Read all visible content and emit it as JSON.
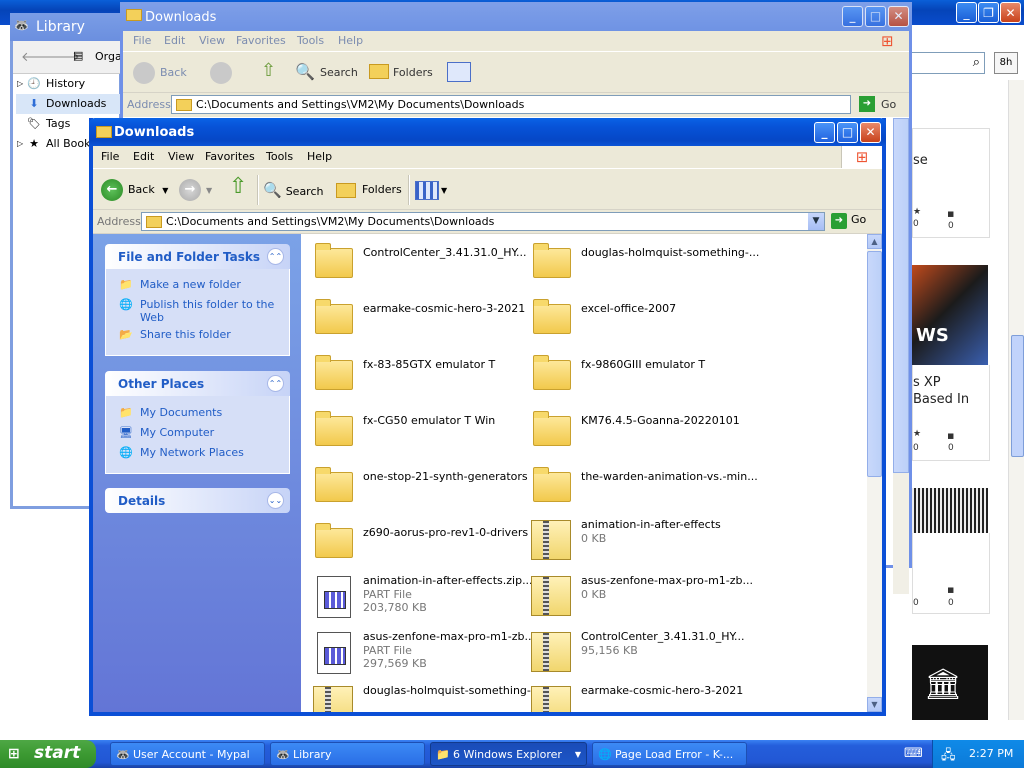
{
  "background_browser": {
    "bg_search_button_text": "8h",
    "cards": [
      {
        "text": "se",
        "likes": "0",
        "comments": "0"
      },
      {
        "text_line1": "s XP",
        "text_line2": "Based In",
        "likes": "0",
        "comments": "0"
      },
      {
        "likes": "0",
        "comments": "0"
      }
    ],
    "image_text": "WS"
  },
  "library_window": {
    "title": "Library",
    "organize": "Orga",
    "items": [
      {
        "label": "History"
      },
      {
        "label": "Downloads"
      },
      {
        "label": "Tags"
      },
      {
        "label": "All Bookm"
      }
    ]
  },
  "back_explorer": {
    "title": "Downloads",
    "menu": [
      "File",
      "Edit",
      "View",
      "Favorites",
      "Tools",
      "Help"
    ],
    "back": "Back",
    "search": "Search",
    "folders": "Folders",
    "address_label": "Address",
    "address": "C:\\Documents and Settings\\VM2\\My Documents\\Downloads",
    "go": "Go"
  },
  "explorer": {
    "title": "Downloads",
    "menu": [
      "File",
      "Edit",
      "View",
      "Favorites",
      "Tools",
      "Help"
    ],
    "toolbar": {
      "back": "Back",
      "search": "Search",
      "folders": "Folders"
    },
    "address_label": "Address",
    "address": "C:\\Documents and Settings\\VM2\\My Documents\\Downloads",
    "go": "Go",
    "task_panels": {
      "file_folder": {
        "title": "File and Folder Tasks",
        "tasks": [
          "Make a new folder",
          "Publish this folder to the",
          "Web",
          "Share this folder"
        ]
      },
      "other_places": {
        "title": "Other Places",
        "links": [
          "My Documents",
          "My Computer",
          "My Network Places"
        ]
      },
      "details": {
        "title": "Details"
      }
    },
    "files": [
      {
        "name": "ControlCenter_3.41.31.0_HY...",
        "type": "folder"
      },
      {
        "name": "douglas-holmquist-something-...",
        "type": "folder"
      },
      {
        "name": "earmake-cosmic-hero-3-2021",
        "type": "folder"
      },
      {
        "name": "excel-office-2007",
        "type": "folder"
      },
      {
        "name": "fx-83-85GTX emulator T",
        "type": "folder"
      },
      {
        "name": "fx-9860GIII emulator T",
        "type": "folder"
      },
      {
        "name": "fx-CG50 emulator T Win",
        "type": "folder"
      },
      {
        "name": "KM76.4.5-Goanna-20220101",
        "type": "folder"
      },
      {
        "name": "one-stop-21-synth-generators",
        "type": "folder"
      },
      {
        "name": "the-warden-animation-vs.-min...",
        "type": "folder"
      },
      {
        "name": "z690-aorus-pro-rev1-0-drivers",
        "type": "folder"
      },
      {
        "name": "animation-in-after-effects",
        "type": "zip",
        "size": "0 KB"
      },
      {
        "name": "animation-in-after-effects.zip....",
        "type": "part",
        "kind": "PART File",
        "size": "203,780 KB"
      },
      {
        "name": "asus-zenfone-max-pro-m1-zb...",
        "type": "zip",
        "size": "0 KB"
      },
      {
        "name": "asus-zenfone-max-pro-m1-zb...",
        "type": "part",
        "kind": "PART File",
        "size": "297,569 KB"
      },
      {
        "name": "ControlCenter_3.41.31.0_HY...",
        "type": "zip",
        "size": "95,156 KB"
      },
      {
        "name": "douglas-holmquist-something-...",
        "type": "zip"
      },
      {
        "name": "earmake-cosmic-hero-3-2021",
        "type": "zip"
      }
    ]
  },
  "taskbar": {
    "start": "start",
    "tasks": [
      {
        "label": "User Account - Mypal"
      },
      {
        "label": "Library"
      },
      {
        "label": "6 Windows Explorer"
      },
      {
        "label": "Page Load Error - K-..."
      }
    ],
    "clock": "2:27 PM"
  }
}
